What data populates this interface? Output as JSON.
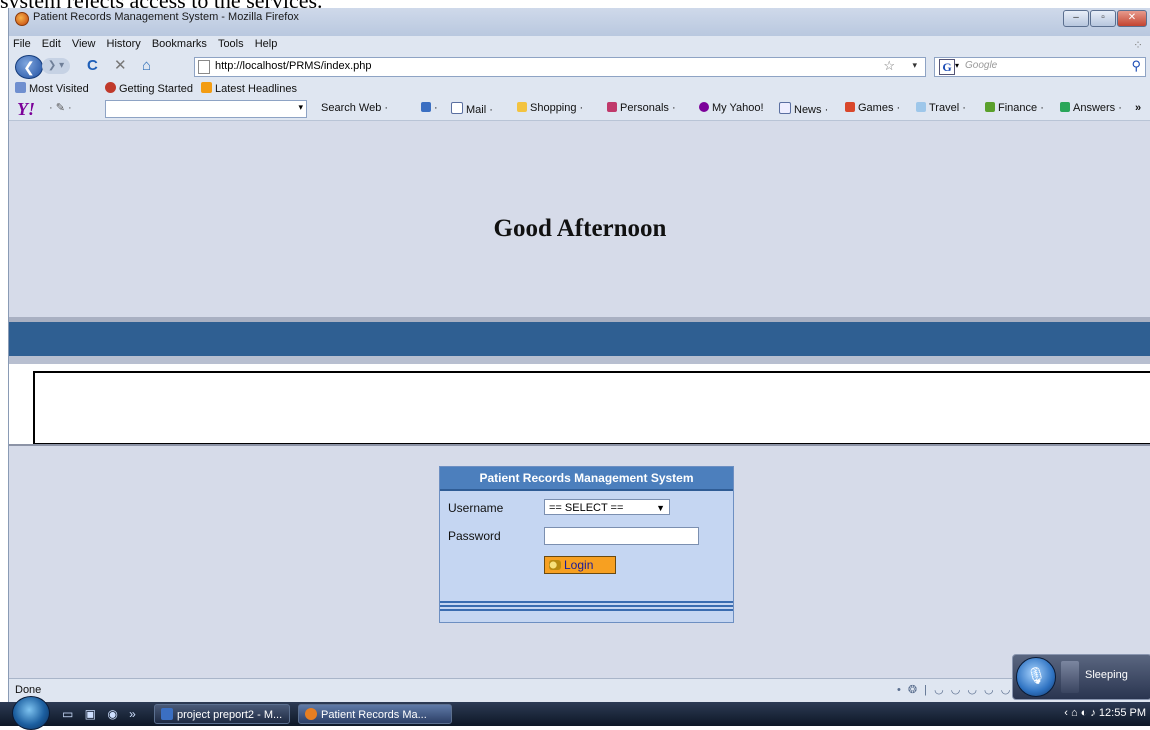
{
  "document_caption": "system rejects access to the services.",
  "window": {
    "title": "Patient Records Management System - Mozilla Firefox",
    "buttons": {
      "minimize": "–",
      "maximize": "▫",
      "close": "✕"
    }
  },
  "menu": [
    "File",
    "Edit",
    "View",
    "History",
    "Bookmarks",
    "Tools",
    "Help"
  ],
  "nav": {
    "url": "http://localhost/PRMS/index.php",
    "search_placeholder": "Google",
    "icons": {
      "back": "back-arrow-icon",
      "forward": "forward-arrow-icon",
      "reload": "reload-icon",
      "stop": "stop-icon",
      "home": "home-icon"
    }
  },
  "bookmarks": [
    "Most Visited",
    "Getting Started",
    "Latest Headlines"
  ],
  "yahoo_toolbar": {
    "search_label": "Search Web",
    "items": [
      "Mail",
      "Shopping",
      "Personals",
      "My Yahoo!",
      "News",
      "Games",
      "Travel",
      "Finance",
      "Answers"
    ],
    "more": "»"
  },
  "page": {
    "greeting": "Good Afternoon",
    "login": {
      "header": "Patient Records Management System",
      "username_label": "Username",
      "username_value": "== SELECT ==",
      "password_label": "Password",
      "button_label": "Login"
    }
  },
  "statusbar": {
    "text": "Done"
  },
  "taskbar": {
    "items": [
      "project preport2 - M...",
      "Patient Records Ma..."
    ],
    "time": "12:55 PM",
    "speech": "Sleeping"
  },
  "colors": {
    "page_bg": "#d6dbe9",
    "band_blue": "#2f5f92",
    "panel_header": "#4c7fbd",
    "panel_bg": "#c5d6f2",
    "login_button": "#f7a021"
  }
}
